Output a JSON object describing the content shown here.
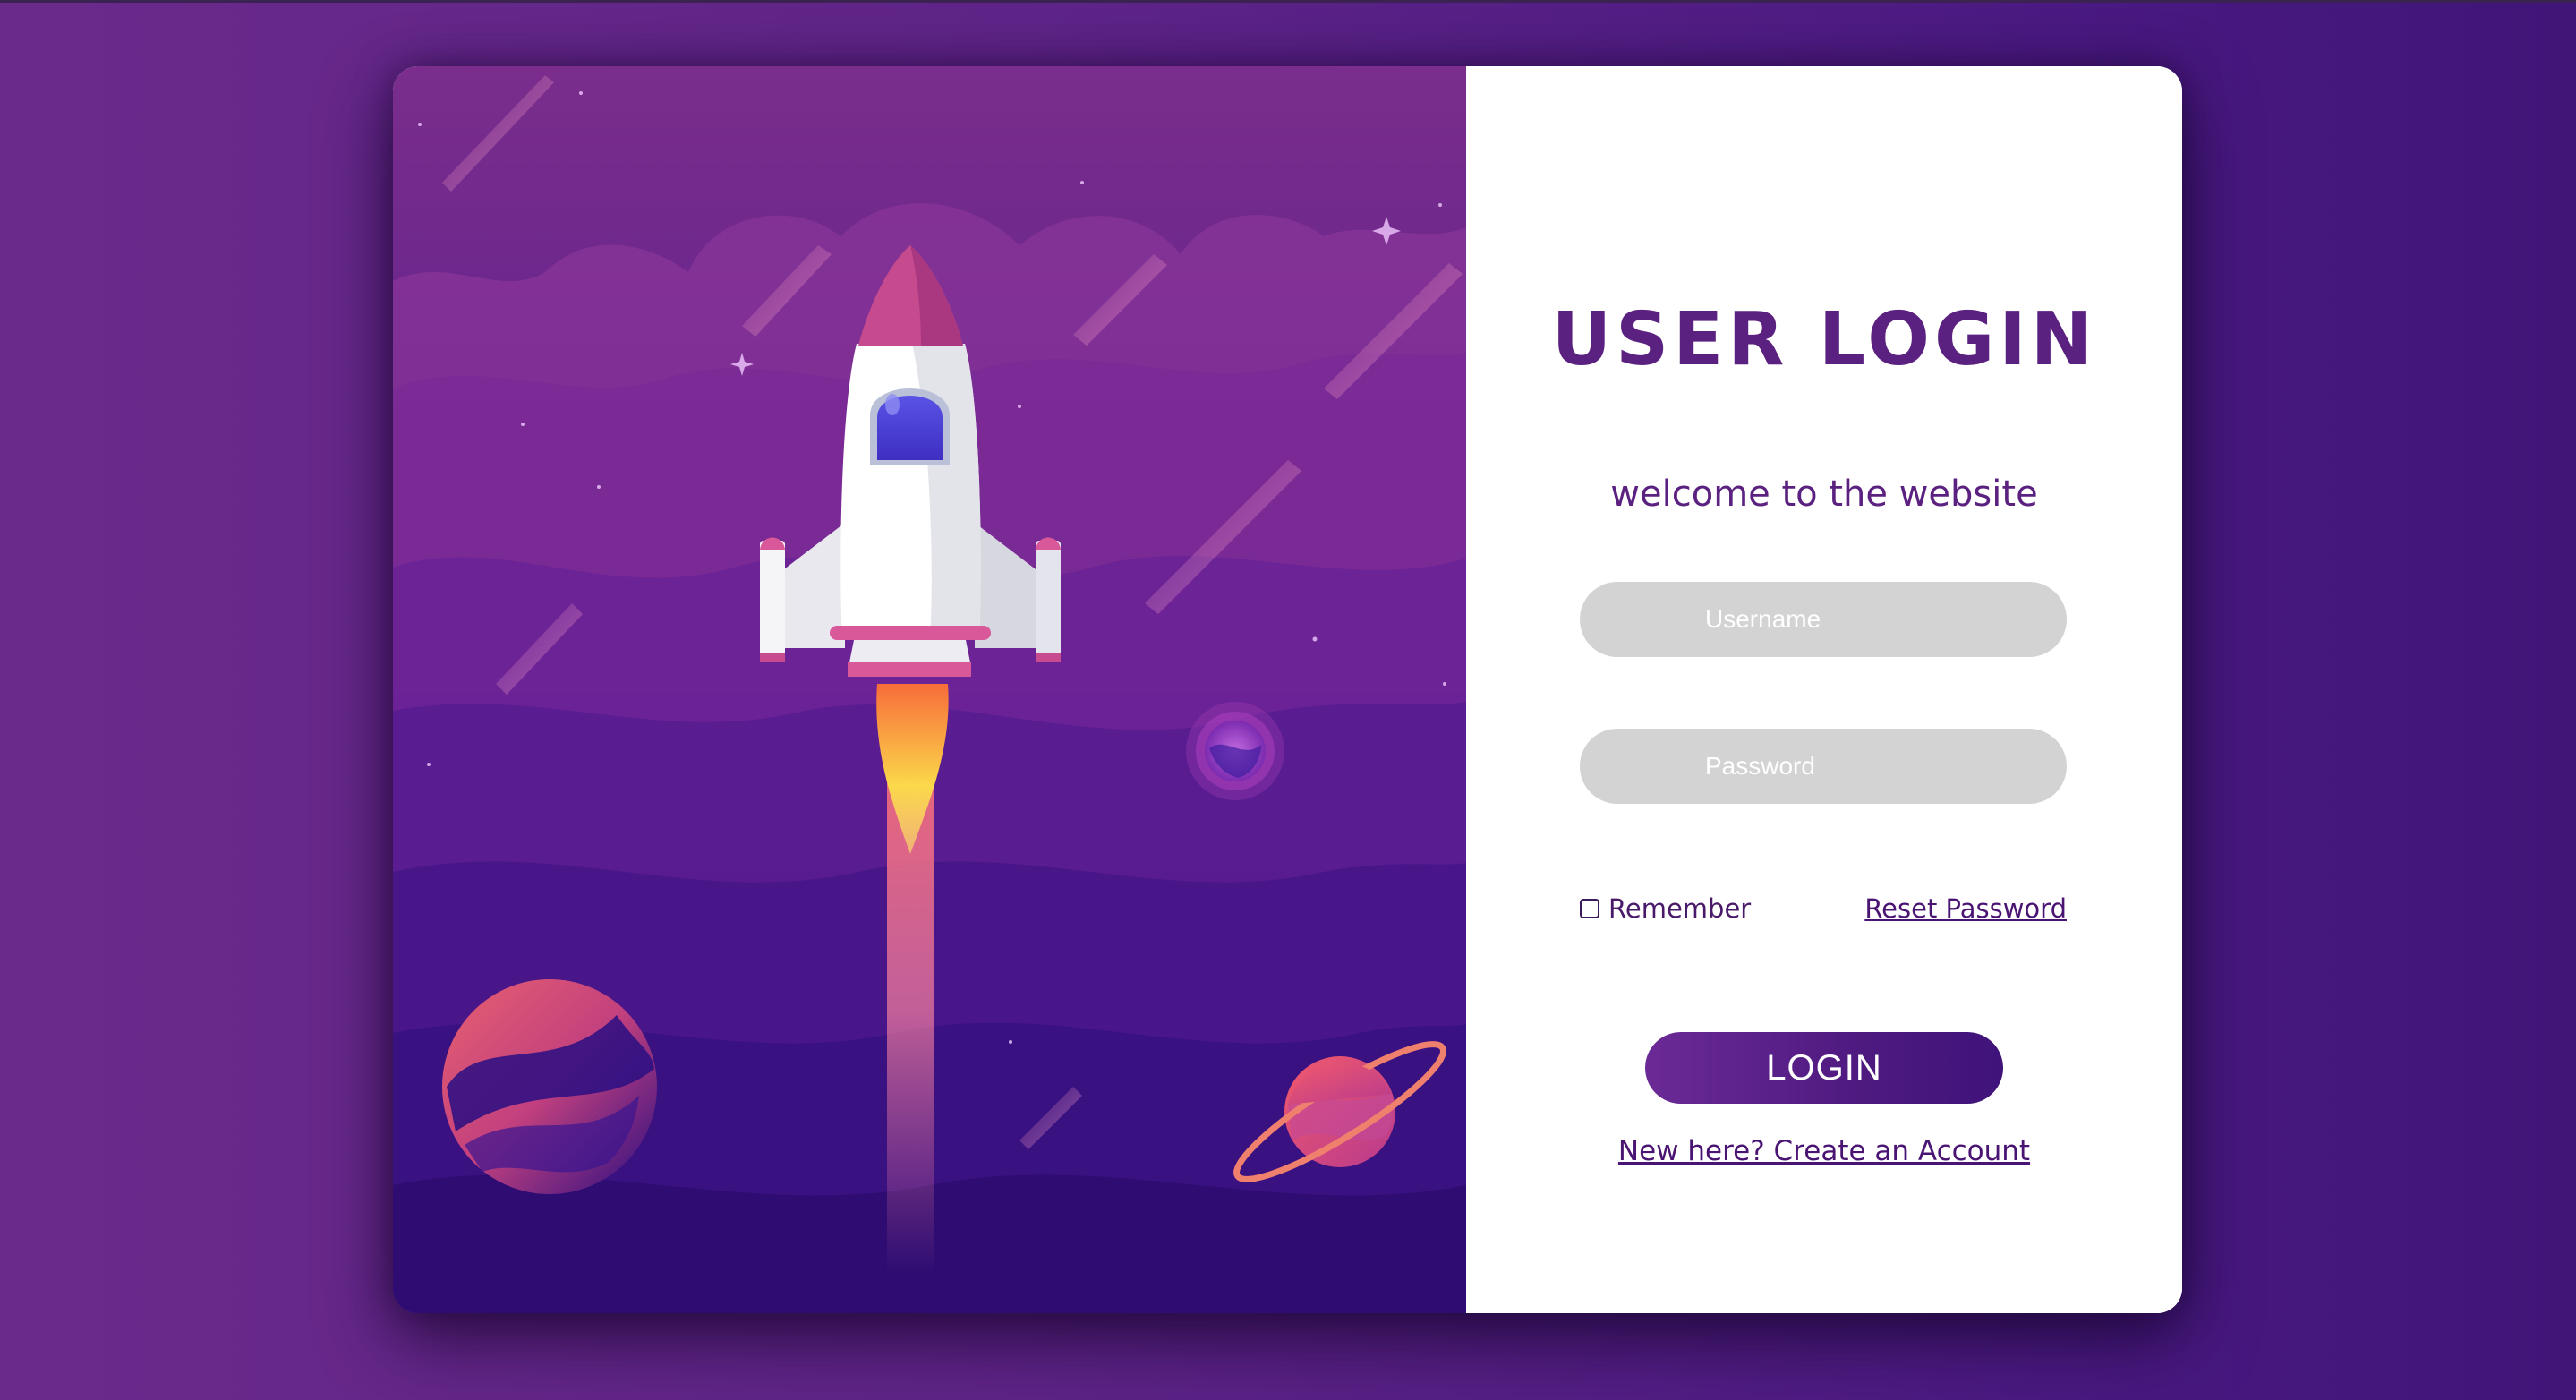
{
  "login": {
    "title": "USER LOGIN",
    "welcome": "welcome to the website",
    "username_placeholder": "Username",
    "password_placeholder": "Password",
    "remember_label": "Remember",
    "reset_password_label": "Reset Password",
    "login_button_label": "LOGIN",
    "create_account_label": "New here? Create an Account"
  },
  "illustration": {
    "icons": [
      "rocket-icon",
      "planet-icon",
      "ringed-planet-icon",
      "small-planet-icon",
      "star-icon",
      "meteor-icon"
    ]
  },
  "colors": {
    "accent": "#5b2180",
    "background": "#5f2488",
    "field_background": "#d3d3d3",
    "button_gradient_start": "#6b2a96",
    "button_gradient_end": "#3f137a",
    "card_background": "#ffffff"
  }
}
